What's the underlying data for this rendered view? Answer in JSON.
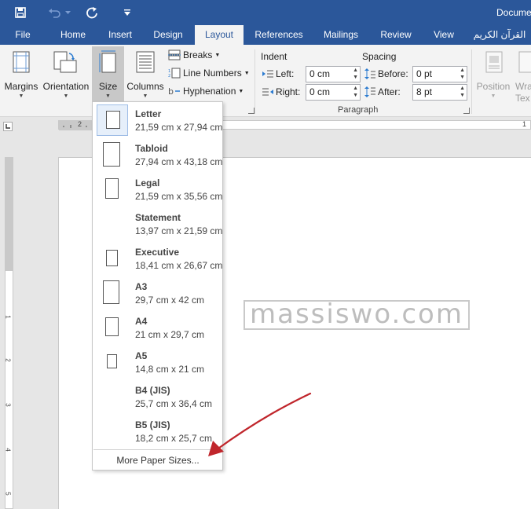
{
  "titlebar": {
    "doc_title": "Docume",
    "icons": [
      "save-icon",
      "undo-icon",
      "redo-icon",
      "customize-quick-access-icon"
    ]
  },
  "tabs": [
    {
      "label": "File"
    },
    {
      "label": "Home"
    },
    {
      "label": "Insert"
    },
    {
      "label": "Design"
    },
    {
      "label": "Layout",
      "active": true
    },
    {
      "label": "References"
    },
    {
      "label": "Mailings"
    },
    {
      "label": "Review"
    },
    {
      "label": "View"
    },
    {
      "label": "القرآن الكريم"
    }
  ],
  "ribbon": {
    "margins_label": "Margins",
    "orientation_label": "Orientation",
    "size_label": "Size",
    "columns_label": "Columns",
    "breaks_label": "Breaks",
    "line_numbers_label": "Line Numbers",
    "hyphenation_label": "Hyphenation",
    "indent_label": "Indent",
    "spacing_label": "Spacing",
    "left_label": "Left:",
    "right_label": "Right:",
    "before_label": "Before:",
    "after_label": "After:",
    "indent_left_value": "0 cm",
    "indent_right_value": "0 cm",
    "spacing_before_value": "0 pt",
    "spacing_after_value": "8 pt",
    "paragraph_group_label": "Paragraph",
    "position_label": "Position",
    "wrap_text_label_partial": "Wra",
    "wrap_text_label_partial2": "Tex"
  },
  "ruler": {
    "h_ticks": [
      "2",
      "1"
    ],
    "v_ticks": [
      "2",
      "1",
      "1",
      "2",
      "3",
      "4",
      "5"
    ]
  },
  "size_menu": {
    "items": [
      {
        "name": "Letter",
        "dims": "21,59 cm x 27,94 cm",
        "selected": true
      },
      {
        "name": "Tabloid",
        "dims": "27,94 cm x 43,18 cm"
      },
      {
        "name": "Legal",
        "dims": "21,59 cm x 35,56 cm"
      },
      {
        "name": "Statement",
        "dims": "13,97 cm x 21,59 cm"
      },
      {
        "name": "Executive",
        "dims": "18,41 cm x 26,67 cm"
      },
      {
        "name": "A3",
        "dims": "29,7 cm x 42 cm"
      },
      {
        "name": "A4",
        "dims": "21 cm x 29,7 cm"
      },
      {
        "name": "A5",
        "dims": "14,8 cm x 21 cm"
      },
      {
        "name": "B4 (JIS)",
        "dims": "25,7 cm x 36,4 cm"
      },
      {
        "name": "B5 (JIS)",
        "dims": "18,2 cm x 25,7 cm"
      }
    ],
    "more_label": "More Paper Sizes..."
  },
  "watermark": "massiswo.com",
  "colors": {
    "title_bar": "#2b579a",
    "ribbon_bg": "#f3f3f3",
    "annotation_arrow": "#c0262c"
  }
}
